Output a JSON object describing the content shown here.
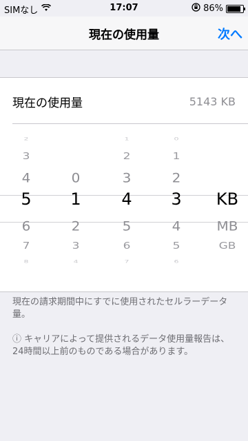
{
  "status": {
    "carrier": "SIMなし",
    "time": "17:07",
    "battery": "86%",
    "battery_level": 0.86
  },
  "nav": {
    "title": "現在の使用量",
    "next": "次へ"
  },
  "usage": {
    "label": "現在の使用量",
    "value": "5143 KB"
  },
  "picker": {
    "columns": [
      {
        "name": "digit-1",
        "items": [
          "2",
          "3",
          "4",
          "5",
          "6",
          "7",
          "8"
        ],
        "selected": "5"
      },
      {
        "name": "digit-2",
        "items": [
          "",
          "",
          "0",
          "1",
          "2",
          "3",
          "4"
        ],
        "selected": "1"
      },
      {
        "name": "digit-3",
        "items": [
          "1",
          "2",
          "3",
          "4",
          "5",
          "6",
          "7"
        ],
        "selected": "4"
      },
      {
        "name": "digit-4",
        "items": [
          "0",
          "1",
          "2",
          "3",
          "4",
          "5",
          "6"
        ],
        "selected": "3"
      },
      {
        "name": "unit",
        "items": [
          "",
          "",
          "",
          "KB",
          "MB",
          "GB",
          ""
        ],
        "selected": "KB"
      }
    ]
  },
  "footer": {
    "note1": "現在の請求期間中にすでに使用されたセルラーデータ量。",
    "note2": "ⓘ キャリアによって提供されるデータ使用量報告は、24時間以上前のものである場合があります。"
  }
}
